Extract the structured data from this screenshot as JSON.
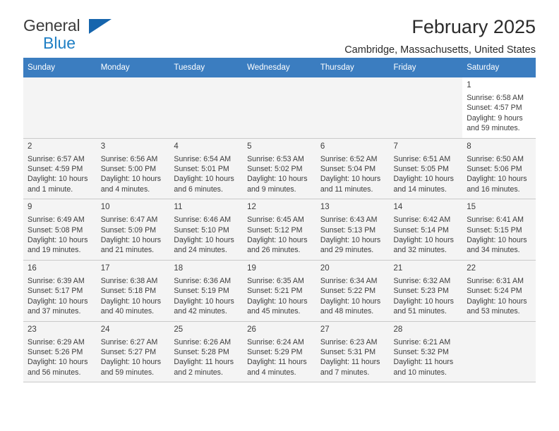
{
  "brand": {
    "name_part1": "General",
    "name_part2": "Blue",
    "triangle_color": "#1665ad",
    "blue_color": "#1f7fc4"
  },
  "header": {
    "title": "February 2025",
    "location": "Cambridge, Massachusetts, United States"
  },
  "theme": {
    "header_row_bg": "#3b7dc0",
    "header_row_text": "#ffffff",
    "shaded_row_bg": "#f4f4f4",
    "border_color": "#c9c9c9",
    "text_color": "#3c3c3c"
  },
  "weekday_headers": [
    "Sunday",
    "Monday",
    "Tuesday",
    "Wednesday",
    "Thursday",
    "Friday",
    "Saturday"
  ],
  "labels": {
    "sunrise": "Sunrise:",
    "sunset": "Sunset:",
    "daylight": "Daylight:"
  },
  "weeks": [
    {
      "shaded": false,
      "days": [
        {
          "empty": true
        },
        {
          "empty": true
        },
        {
          "empty": true
        },
        {
          "empty": true
        },
        {
          "empty": true
        },
        {
          "empty": true
        },
        {
          "empty": false,
          "date": "1",
          "sunrise": "Sunrise: 6:58 AM",
          "sunset": "Sunset: 4:57 PM",
          "daylight_line1": "Daylight: 9 hours",
          "daylight_line2": "and 59 minutes."
        }
      ]
    },
    {
      "shaded": true,
      "days": [
        {
          "empty": false,
          "date": "2",
          "sunrise": "Sunrise: 6:57 AM",
          "sunset": "Sunset: 4:59 PM",
          "daylight_line1": "Daylight: 10 hours",
          "daylight_line2": "and 1 minute."
        },
        {
          "empty": false,
          "date": "3",
          "sunrise": "Sunrise: 6:56 AM",
          "sunset": "Sunset: 5:00 PM",
          "daylight_line1": "Daylight: 10 hours",
          "daylight_line2": "and 4 minutes."
        },
        {
          "empty": false,
          "date": "4",
          "sunrise": "Sunrise: 6:54 AM",
          "sunset": "Sunset: 5:01 PM",
          "daylight_line1": "Daylight: 10 hours",
          "daylight_line2": "and 6 minutes."
        },
        {
          "empty": false,
          "date": "5",
          "sunrise": "Sunrise: 6:53 AM",
          "sunset": "Sunset: 5:02 PM",
          "daylight_line1": "Daylight: 10 hours",
          "daylight_line2": "and 9 minutes."
        },
        {
          "empty": false,
          "date": "6",
          "sunrise": "Sunrise: 6:52 AM",
          "sunset": "Sunset: 5:04 PM",
          "daylight_line1": "Daylight: 10 hours",
          "daylight_line2": "and 11 minutes."
        },
        {
          "empty": false,
          "date": "7",
          "sunrise": "Sunrise: 6:51 AM",
          "sunset": "Sunset: 5:05 PM",
          "daylight_line1": "Daylight: 10 hours",
          "daylight_line2": "and 14 minutes."
        },
        {
          "empty": false,
          "date": "8",
          "sunrise": "Sunrise: 6:50 AM",
          "sunset": "Sunset: 5:06 PM",
          "daylight_line1": "Daylight: 10 hours",
          "daylight_line2": "and 16 minutes."
        }
      ]
    },
    {
      "shaded": true,
      "days": [
        {
          "empty": false,
          "date": "9",
          "sunrise": "Sunrise: 6:49 AM",
          "sunset": "Sunset: 5:08 PM",
          "daylight_line1": "Daylight: 10 hours",
          "daylight_line2": "and 19 minutes."
        },
        {
          "empty": false,
          "date": "10",
          "sunrise": "Sunrise: 6:47 AM",
          "sunset": "Sunset: 5:09 PM",
          "daylight_line1": "Daylight: 10 hours",
          "daylight_line2": "and 21 minutes."
        },
        {
          "empty": false,
          "date": "11",
          "sunrise": "Sunrise: 6:46 AM",
          "sunset": "Sunset: 5:10 PM",
          "daylight_line1": "Daylight: 10 hours",
          "daylight_line2": "and 24 minutes."
        },
        {
          "empty": false,
          "date": "12",
          "sunrise": "Sunrise: 6:45 AM",
          "sunset": "Sunset: 5:12 PM",
          "daylight_line1": "Daylight: 10 hours",
          "daylight_line2": "and 26 minutes."
        },
        {
          "empty": false,
          "date": "13",
          "sunrise": "Sunrise: 6:43 AM",
          "sunset": "Sunset: 5:13 PM",
          "daylight_line1": "Daylight: 10 hours",
          "daylight_line2": "and 29 minutes."
        },
        {
          "empty": false,
          "date": "14",
          "sunrise": "Sunrise: 6:42 AM",
          "sunset": "Sunset: 5:14 PM",
          "daylight_line1": "Daylight: 10 hours",
          "daylight_line2": "and 32 minutes."
        },
        {
          "empty": false,
          "date": "15",
          "sunrise": "Sunrise: 6:41 AM",
          "sunset": "Sunset: 5:15 PM",
          "daylight_line1": "Daylight: 10 hours",
          "daylight_line2": "and 34 minutes."
        }
      ]
    },
    {
      "shaded": true,
      "days": [
        {
          "empty": false,
          "date": "16",
          "sunrise": "Sunrise: 6:39 AM",
          "sunset": "Sunset: 5:17 PM",
          "daylight_line1": "Daylight: 10 hours",
          "daylight_line2": "and 37 minutes."
        },
        {
          "empty": false,
          "date": "17",
          "sunrise": "Sunrise: 6:38 AM",
          "sunset": "Sunset: 5:18 PM",
          "daylight_line1": "Daylight: 10 hours",
          "daylight_line2": "and 40 minutes."
        },
        {
          "empty": false,
          "date": "18",
          "sunrise": "Sunrise: 6:36 AM",
          "sunset": "Sunset: 5:19 PM",
          "daylight_line1": "Daylight: 10 hours",
          "daylight_line2": "and 42 minutes."
        },
        {
          "empty": false,
          "date": "19",
          "sunrise": "Sunrise: 6:35 AM",
          "sunset": "Sunset: 5:21 PM",
          "daylight_line1": "Daylight: 10 hours",
          "daylight_line2": "and 45 minutes."
        },
        {
          "empty": false,
          "date": "20",
          "sunrise": "Sunrise: 6:34 AM",
          "sunset": "Sunset: 5:22 PM",
          "daylight_line1": "Daylight: 10 hours",
          "daylight_line2": "and 48 minutes."
        },
        {
          "empty": false,
          "date": "21",
          "sunrise": "Sunrise: 6:32 AM",
          "sunset": "Sunset: 5:23 PM",
          "daylight_line1": "Daylight: 10 hours",
          "daylight_line2": "and 51 minutes."
        },
        {
          "empty": false,
          "date": "22",
          "sunrise": "Sunrise: 6:31 AM",
          "sunset": "Sunset: 5:24 PM",
          "daylight_line1": "Daylight: 10 hours",
          "daylight_line2": "and 53 minutes."
        }
      ]
    },
    {
      "shaded": true,
      "days": [
        {
          "empty": false,
          "date": "23",
          "sunrise": "Sunrise: 6:29 AM",
          "sunset": "Sunset: 5:26 PM",
          "daylight_line1": "Daylight: 10 hours",
          "daylight_line2": "and 56 minutes."
        },
        {
          "empty": false,
          "date": "24",
          "sunrise": "Sunrise: 6:27 AM",
          "sunset": "Sunset: 5:27 PM",
          "daylight_line1": "Daylight: 10 hours",
          "daylight_line2": "and 59 minutes."
        },
        {
          "empty": false,
          "date": "25",
          "sunrise": "Sunrise: 6:26 AM",
          "sunset": "Sunset: 5:28 PM",
          "daylight_line1": "Daylight: 11 hours",
          "daylight_line2": "and 2 minutes."
        },
        {
          "empty": false,
          "date": "26",
          "sunrise": "Sunrise: 6:24 AM",
          "sunset": "Sunset: 5:29 PM",
          "daylight_line1": "Daylight: 11 hours",
          "daylight_line2": "and 4 minutes."
        },
        {
          "empty": false,
          "date": "27",
          "sunrise": "Sunrise: 6:23 AM",
          "sunset": "Sunset: 5:31 PM",
          "daylight_line1": "Daylight: 11 hours",
          "daylight_line2": "and 7 minutes."
        },
        {
          "empty": false,
          "date": "28",
          "sunrise": "Sunrise: 6:21 AM",
          "sunset": "Sunset: 5:32 PM",
          "daylight_line1": "Daylight: 11 hours",
          "daylight_line2": "and 10 minutes."
        },
        {
          "empty": true
        }
      ]
    }
  ]
}
